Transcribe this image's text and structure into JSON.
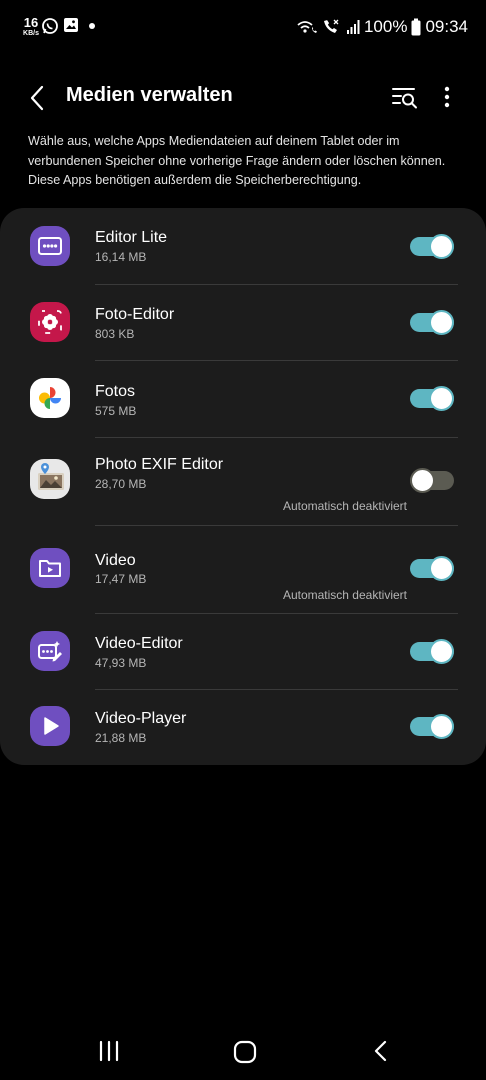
{
  "status_bar": {
    "speed_value": "16",
    "speed_unit": "KB/s",
    "battery": "100%",
    "time": "09:34",
    "icons": [
      "whatsapp-icon",
      "gallery-icon",
      "notification-dot-icon",
      "wifi-call-icon",
      "volte-call-icon",
      "signal-icon",
      "battery-icon"
    ]
  },
  "header": {
    "title": "Medien verwalten"
  },
  "description": "Wähle aus, welche Apps Mediendateien auf deinem Tablet oder im verbundenen Speicher ohne vorherige Frage ändern oder löschen können. Diese Apps benötigen außerdem die Speicherberechtigung.",
  "apps": [
    {
      "name": "Editor Lite",
      "size": "16,14 MB",
      "note": "",
      "enabled": true,
      "icon": "editor-lite-icon",
      "icon_color": "#6f4fc0"
    },
    {
      "name": "Foto-Editor",
      "size": "803 KB",
      "note": "",
      "enabled": true,
      "icon": "photo-editor-icon",
      "icon_color": "#c4174a"
    },
    {
      "name": "Fotos",
      "size": "575 MB",
      "note": "",
      "enabled": true,
      "icon": "google-photos-icon",
      "icon_color": "#ffffff"
    },
    {
      "name": "Photo EXIF Editor",
      "size": "28,70 MB",
      "note": "Automatisch deaktiviert",
      "enabled": false,
      "icon": "photo-exif-editor-icon",
      "icon_color": "#e8e8e8"
    },
    {
      "name": "Video",
      "size": "17,47 MB",
      "note": "Automatisch deaktiviert",
      "enabled": true,
      "icon": "video-icon",
      "icon_color": "#6f4fc0"
    },
    {
      "name": "Video-Editor",
      "size": "47,93 MB",
      "note": "",
      "enabled": true,
      "icon": "video-editor-icon",
      "icon_color": "#6f4fc0"
    },
    {
      "name": "Video-Player",
      "size": "21,88 MB",
      "note": "",
      "enabled": true,
      "icon": "video-player-icon",
      "icon_color": "#6f4fc0"
    }
  ],
  "colors": {
    "background": "#000000",
    "card": "#1c1c1c",
    "toggle_on": "#5eb6c2",
    "toggle_off": "#5b5b52"
  }
}
